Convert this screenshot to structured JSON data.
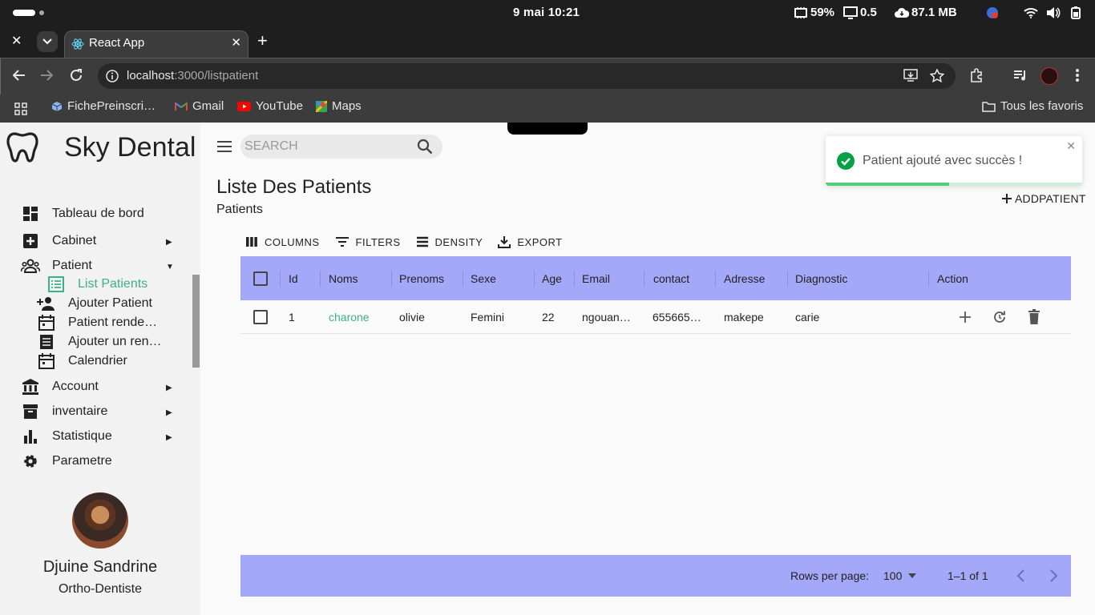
{
  "os": {
    "clock": "9 mai  10:21",
    "battery_saver": "59%",
    "load": "0.5",
    "net": "87.1 MB"
  },
  "browser": {
    "tab_title": "React App",
    "url_host": "localhost",
    "url_path": ":3000/listpatient",
    "bookmarks": [
      "FichePreinscri…",
      "Gmail",
      "YouTube",
      "Maps"
    ],
    "all_bookmarks": "Tous les favoris"
  },
  "sidebar": {
    "brand": "Sky Dental",
    "items": [
      {
        "label": "Tableau de bord",
        "icon": "dashboard-icon"
      },
      {
        "label": "Cabinet",
        "icon": "add-box-icon"
      },
      {
        "label": "Patient",
        "icon": "group-icon"
      },
      {
        "label": "Account",
        "icon": "bank-icon"
      },
      {
        "label": "inventaire",
        "icon": "archive-icon"
      },
      {
        "label": "Statistique",
        "icon": "bar-chart-icon"
      },
      {
        "label": "Parametre",
        "icon": "gear-icon"
      }
    ],
    "sub_items": [
      {
        "label": "List Patients",
        "icon": "list-icon"
      },
      {
        "label": "Ajouter Patient",
        "icon": "person-add-icon"
      },
      {
        "label": "Patient rende…",
        "icon": "calendar-icon"
      },
      {
        "label": "Ajouter un ren…",
        "icon": "notes-icon"
      },
      {
        "label": "Calendrier",
        "icon": "calendar-icon"
      }
    ],
    "user_name": "Djuine Sandrine",
    "user_role": "Ortho-Dentiste"
  },
  "main": {
    "search_placeholder": "SEARCH",
    "title": "Liste Des Patients",
    "subtitle": "Patients",
    "add_button": "ADDPATIENT",
    "toolbar": [
      "COLUMNS",
      "FILTERS",
      "DENSITY",
      "EXPORT"
    ],
    "columns": [
      "Id",
      "Noms",
      "Prenoms",
      "Sexe",
      "Age",
      "Email",
      "contact",
      "Adresse",
      "Diagnostic",
      "Action"
    ],
    "rows": [
      {
        "id": "1",
        "nom": "charone",
        "prenom": "olivie",
        "sexe": "Femini",
        "age": "22",
        "email": "ngouan…",
        "contact": "655665…",
        "adresse": "makepe",
        "diagnostic": "carie"
      }
    ],
    "footer": {
      "rows_per_page_label": "Rows per page:",
      "rows_per_page": "100",
      "range": "1–1 of 1"
    }
  },
  "toast": {
    "message": "Patient ajouté avec succès !",
    "progress": 0.48
  },
  "colors": {
    "grid_header": "#a3a8f8",
    "accent_green": "#3cb08a",
    "toast_green": "#4cd07a"
  }
}
